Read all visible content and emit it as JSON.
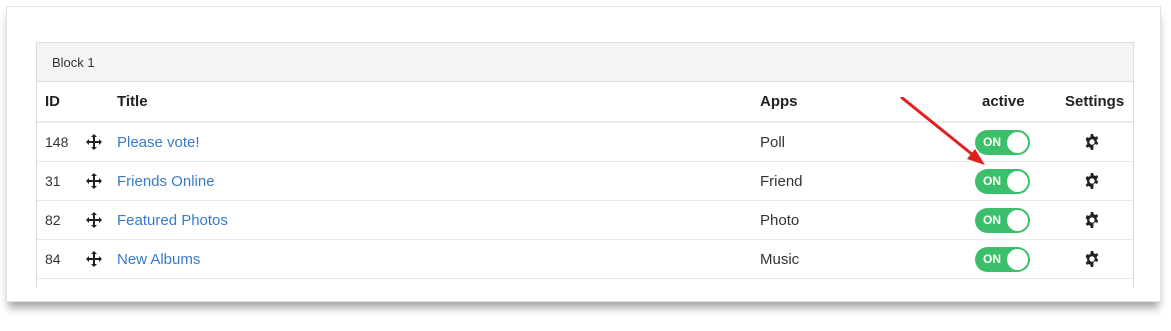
{
  "block": {
    "title": "Block 1"
  },
  "table": {
    "headers": {
      "id": "ID",
      "title": "Title",
      "apps": "Apps",
      "active": "active",
      "settings": "Settings"
    },
    "rows": [
      {
        "id": "148",
        "title": "Please vote!",
        "app": "Poll",
        "active": "ON"
      },
      {
        "id": "31",
        "title": "Friends Online",
        "app": "Friend",
        "active": "ON"
      },
      {
        "id": "82",
        "title": "Featured Photos",
        "app": "Photo",
        "active": "ON"
      },
      {
        "id": "84",
        "title": "New Albums",
        "app": "Music",
        "active": "ON"
      }
    ]
  },
  "icons": {
    "drag": "move-icon",
    "settings": "gear-icon",
    "annotation": "red-arrow-icon"
  },
  "colors": {
    "toggle_on": "#3cbf6a",
    "link": "#3a7bc8",
    "annotation_arrow": "#e02020"
  }
}
